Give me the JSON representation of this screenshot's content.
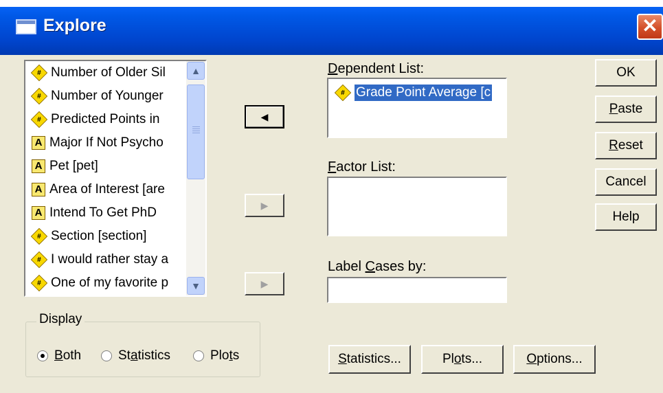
{
  "window": {
    "title": "Explore"
  },
  "variables": [
    {
      "label": "Number of Older Sil",
      "type": "numeric"
    },
    {
      "label": "Number of Younger",
      "type": "numeric"
    },
    {
      "label": "Predicted Points in",
      "type": "numeric"
    },
    {
      "label": "Major If Not Psycho",
      "type": "string"
    },
    {
      "label": "Pet [pet]",
      "type": "string"
    },
    {
      "label": "Area of Interest [are",
      "type": "string"
    },
    {
      "label": "Intend To Get PhD",
      "type": "string"
    },
    {
      "label": "Section [section]",
      "type": "numeric"
    },
    {
      "label": "I would rather stay a",
      "type": "numeric"
    },
    {
      "label": "One of my favorite p",
      "type": "numeric"
    }
  ],
  "dependent": {
    "label_prefix": "D",
    "label_rest": "ependent List:",
    "items": [
      {
        "label": "Grade Point Average [c",
        "type": "numeric"
      }
    ]
  },
  "factor": {
    "label_prefix": "F",
    "label_rest": "actor List:"
  },
  "label_cases": {
    "label_prefix": "Label ",
    "label_key": "C",
    "label_rest": "ases by:"
  },
  "buttons": {
    "ok": "OK",
    "paste_key": "P",
    "paste_rest": "aste",
    "reset_key": "R",
    "reset_rest": "eset",
    "cancel": "Cancel",
    "help": "Help",
    "statistics_key": "S",
    "statistics_rest": "tatistics...",
    "plots_pre": "Pl",
    "plots_key": "o",
    "plots_rest": "ts...",
    "options_key": "O",
    "options_rest": "ptions..."
  },
  "display": {
    "title": "Display",
    "options": [
      {
        "pre": "",
        "key": "B",
        "rest": "oth",
        "selected": true
      },
      {
        "pre": "St",
        "key": "a",
        "rest": "tistics",
        "selected": false
      },
      {
        "pre": "Plo",
        "key": "t",
        "rest": "s",
        "selected": false
      }
    ]
  },
  "icons": {
    "numeric": "#",
    "string": "A"
  },
  "arrows": {
    "move_left": "◀",
    "move_right": "▶"
  },
  "colors": {
    "title_bar": "#0054e3",
    "selection": "#316ac5",
    "dialog_bg": "#ece9d8"
  }
}
